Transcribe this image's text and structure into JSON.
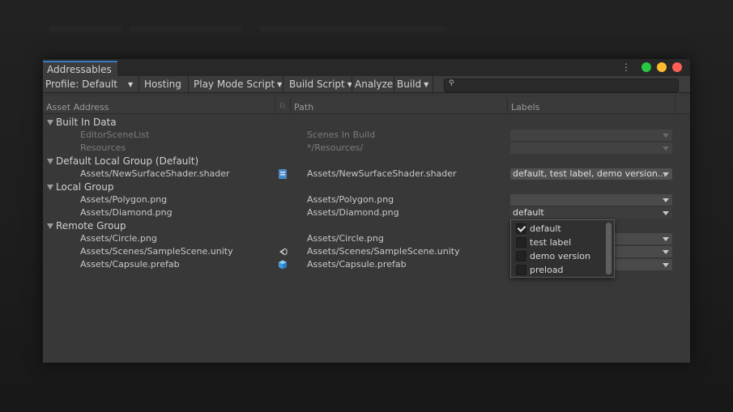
{
  "window": {
    "tab_label": "Addressables",
    "menu_icon": "kebab-menu-icon",
    "colors": {
      "close": "#ff5f57",
      "minimize": "#febc2e",
      "zoom": "#28c840"
    }
  },
  "toolbar": {
    "profile": "Profile: Default",
    "hosting": "Hosting",
    "play_mode": "Play Mode Script",
    "build_script": "Build Script",
    "analyze": "Analyze",
    "build": "Build",
    "search_placeholder": ""
  },
  "columns": {
    "asset_address": "Asset Address",
    "path": "Path",
    "labels": "Labels"
  },
  "groups": [
    {
      "name": "Built In Data",
      "entries": [
        {
          "address": "EditorSceneList",
          "icon": "",
          "path": "Scenes In Build",
          "labels": "",
          "disabled": true
        },
        {
          "address": "Resources",
          "icon": "",
          "path": "*/Resources/",
          "labels": "",
          "disabled": true
        }
      ]
    },
    {
      "name": "Default Local Group (Default)",
      "entries": [
        {
          "address": "Assets/NewSurfaceShader.shader",
          "icon": "shader-icon",
          "path": "Assets/NewSurfaceShader.shader",
          "labels": "default, test label, demo version...",
          "disabled": false
        }
      ]
    },
    {
      "name": "Local Group",
      "entries": [
        {
          "address": "Assets/Polygon.png",
          "icon": "",
          "path": "Assets/Polygon.png",
          "labels": "",
          "disabled": false
        },
        {
          "address": "Assets/Diamond.png",
          "icon": "",
          "path": "Assets/Diamond.png",
          "labels": "default",
          "disabled": false
        }
      ]
    },
    {
      "name": "Remote Group",
      "entries": [
        {
          "address": "Assets/Circle.png",
          "icon": "",
          "path": "Assets/Circle.png",
          "labels": "",
          "disabled": false
        },
        {
          "address": "Assets/Scenes/SampleScene.unity",
          "icon": "unity-scene-icon",
          "path": "Assets/Scenes/SampleScene.unity",
          "labels": "",
          "disabled": false
        },
        {
          "address": "Assets/Capsule.prefab",
          "icon": "prefab-cube-icon",
          "path": "Assets/Capsule.prefab",
          "labels": "",
          "disabled": false
        }
      ]
    }
  ],
  "label_popup": {
    "options": [
      {
        "label": "default",
        "checked": true
      },
      {
        "label": "test label",
        "checked": false
      },
      {
        "label": "demo version",
        "checked": false
      },
      {
        "label": "preload",
        "checked": false
      }
    ]
  }
}
